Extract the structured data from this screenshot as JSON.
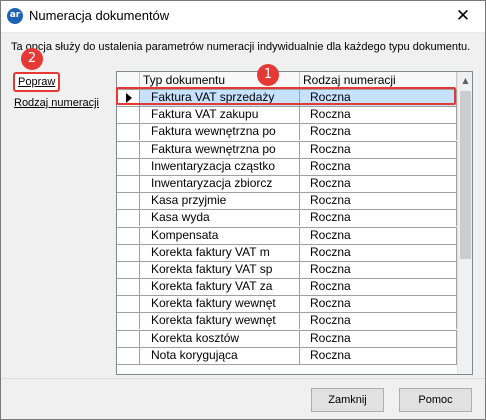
{
  "window": {
    "title": "Numeracja dokumentów",
    "app_icon_text": "ar"
  },
  "description": "Ta opcja służy do ustalenia parametrów numeracji indywidualnie dla każdego typu dokumentu.",
  "links": {
    "popraw": "Popraw",
    "rodzaj_numeracji": "Rodzaj numeracji"
  },
  "annotations": {
    "badge1": "1",
    "badge2": "2",
    "highlight_color": "#e53935"
  },
  "grid": {
    "columns": [
      "Typ dokumentu",
      "Rodzaj numeracji"
    ],
    "selected_index": 0,
    "rows": [
      {
        "typ": "Faktura VAT sprzedaży",
        "rodzaj": "Roczna"
      },
      {
        "typ": "Faktura VAT zakupu",
        "rodzaj": "Roczna"
      },
      {
        "typ": "Faktura wewnętrzna po",
        "rodzaj": "Roczna"
      },
      {
        "typ": "Faktura wewnętrzna po",
        "rodzaj": "Roczna"
      },
      {
        "typ": "Inwentaryzacja cząstko",
        "rodzaj": "Roczna"
      },
      {
        "typ": "Inwentaryzacja zbiorcz",
        "rodzaj": "Roczna"
      },
      {
        "typ": "Kasa przyjmie",
        "rodzaj": "Roczna"
      },
      {
        "typ": "Kasa wyda",
        "rodzaj": "Roczna"
      },
      {
        "typ": "Kompensata",
        "rodzaj": "Roczna"
      },
      {
        "typ": "Korekta faktury VAT m",
        "rodzaj": "Roczna"
      },
      {
        "typ": "Korekta faktury VAT sp",
        "rodzaj": "Roczna"
      },
      {
        "typ": "Korekta faktury VAT za",
        "rodzaj": "Roczna"
      },
      {
        "typ": "Korekta faktury wewnęt",
        "rodzaj": "Roczna"
      },
      {
        "typ": "Korekta faktury wewnęt",
        "rodzaj": "Roczna"
      },
      {
        "typ": "Korekta kosztów",
        "rodzaj": "Roczna"
      },
      {
        "typ": "Nota korygująca",
        "rodzaj": "Roczna"
      }
    ]
  },
  "buttons": {
    "zamknij": "Zamknij",
    "pomoc": "Pomoc"
  },
  "icons": {
    "close": "close-icon",
    "row_pointer": "triangle-right-icon",
    "scroll_up": "chevron-up-icon"
  }
}
